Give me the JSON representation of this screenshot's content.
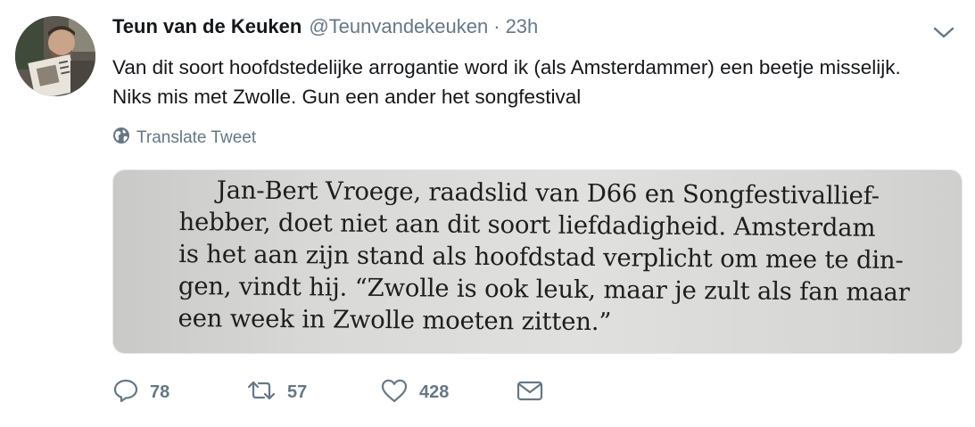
{
  "author": {
    "display_name": "Teun van de Keuken",
    "handle": "@Teunvandekeuken",
    "separator": "·",
    "timestamp": "23h"
  },
  "tweet": {
    "text": "Van dit soort hoofdstedelijke arrogantie word ik (als Amsterdammer) een beetje misselijk. Niks mis met Zwolle. Gun een ander het songfestival"
  },
  "translate": {
    "label": "Translate Tweet",
    "icon": "globe-icon"
  },
  "media": {
    "lines": [
      "Jan-Bert Vroege, raadslid van D66 en Songfestivallief-",
      "hebber, doet niet aan dit soort liefdadigheid. Amsterdam",
      "is het aan zijn stand als hoofdstad verplicht om mee te din-",
      "gen, vindt hij. “Zwolle is ook leuk, maar je zult als fan maar",
      "een week in Zwolle moeten zitten.”"
    ]
  },
  "actions": {
    "reply_count": "78",
    "retweet_count": "57",
    "like_count": "428",
    "icons": [
      "reply-icon",
      "retweet-icon",
      "heart-icon",
      "mail-icon"
    ]
  },
  "colors": {
    "text": "#14171a",
    "secondary": "#657786",
    "border": "#e1e8ed"
  }
}
